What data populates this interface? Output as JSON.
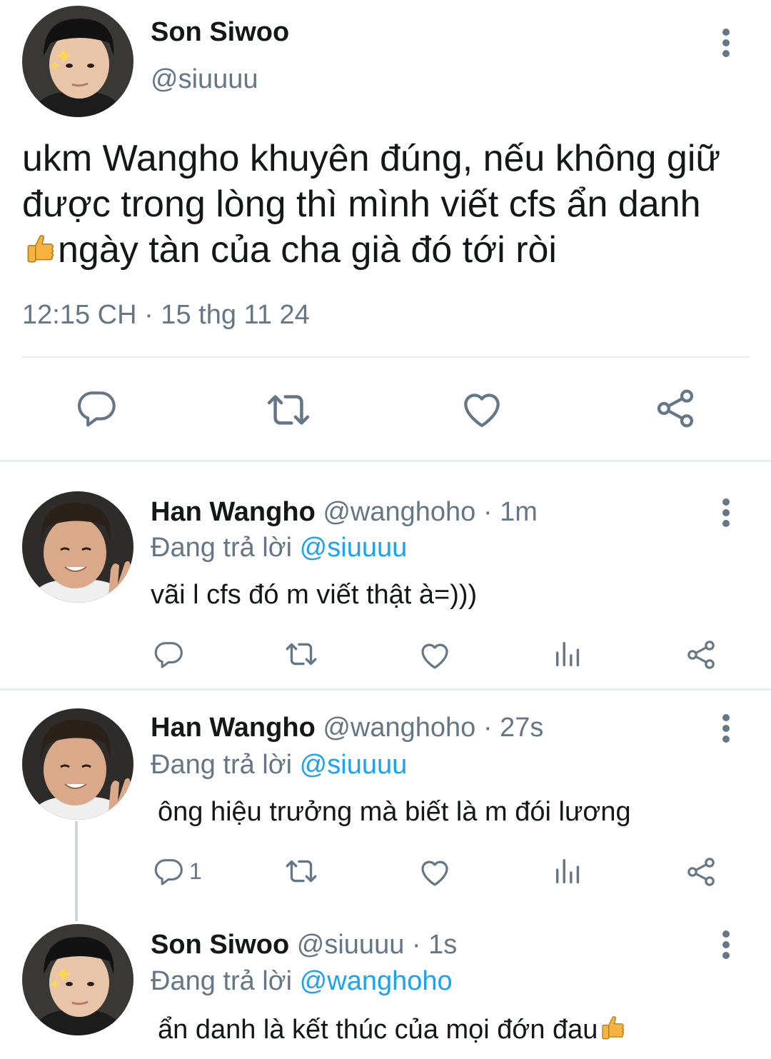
{
  "colors": {
    "muted": "#657786",
    "link": "#1da1f2",
    "text": "#14171a",
    "divider": "#e6ecf0"
  },
  "main_tweet": {
    "author_name": "Son Siwoo",
    "author_handle": "@siuuuu",
    "text_line1": "ukm Wangho khuyên đúng, nếu không giữ",
    "text_line2": "được trong lòng thì mình viết cfs ẩn danh",
    "text_line3": "ngày tàn của cha già đó tới ròi",
    "emoji_icon": "thumbs-up-icon",
    "timestamp": "12:15 CH · 15 thg 11 24",
    "actions": [
      "reply-icon",
      "retweet-icon",
      "like-icon",
      "share-icon"
    ]
  },
  "replies": [
    {
      "author_name": "Han Wangho",
      "meta": "@wanghoho · 1m",
      "replying_prefix": "Đang trả lời",
      "replying_to": "@siuuuu",
      "text": "vãi l cfs đó m viết thật à=)))",
      "reply_count": "",
      "actions": [
        "reply-icon",
        "retweet-icon",
        "like-icon",
        "analytics-icon",
        "share-icon"
      ]
    },
    {
      "author_name": "Han Wangho",
      "meta": "@wanghoho · 27s",
      "replying_prefix": "Đang trả lời",
      "replying_to": "@siuuuu",
      "text": "ông hiệu trưởng mà biết là m đói lương",
      "reply_count": "1",
      "actions": [
        "reply-icon",
        "retweet-icon",
        "like-icon",
        "analytics-icon",
        "share-icon"
      ]
    },
    {
      "author_name": "Son Siwoo",
      "meta": "@siuuuu · 1s",
      "replying_prefix": "Đang trả lời",
      "replying_to": "@wanghoho",
      "text": "ẩn danh là kết thúc của mọi đớn đau",
      "emoji_icon": "thumbs-up-icon"
    }
  ]
}
